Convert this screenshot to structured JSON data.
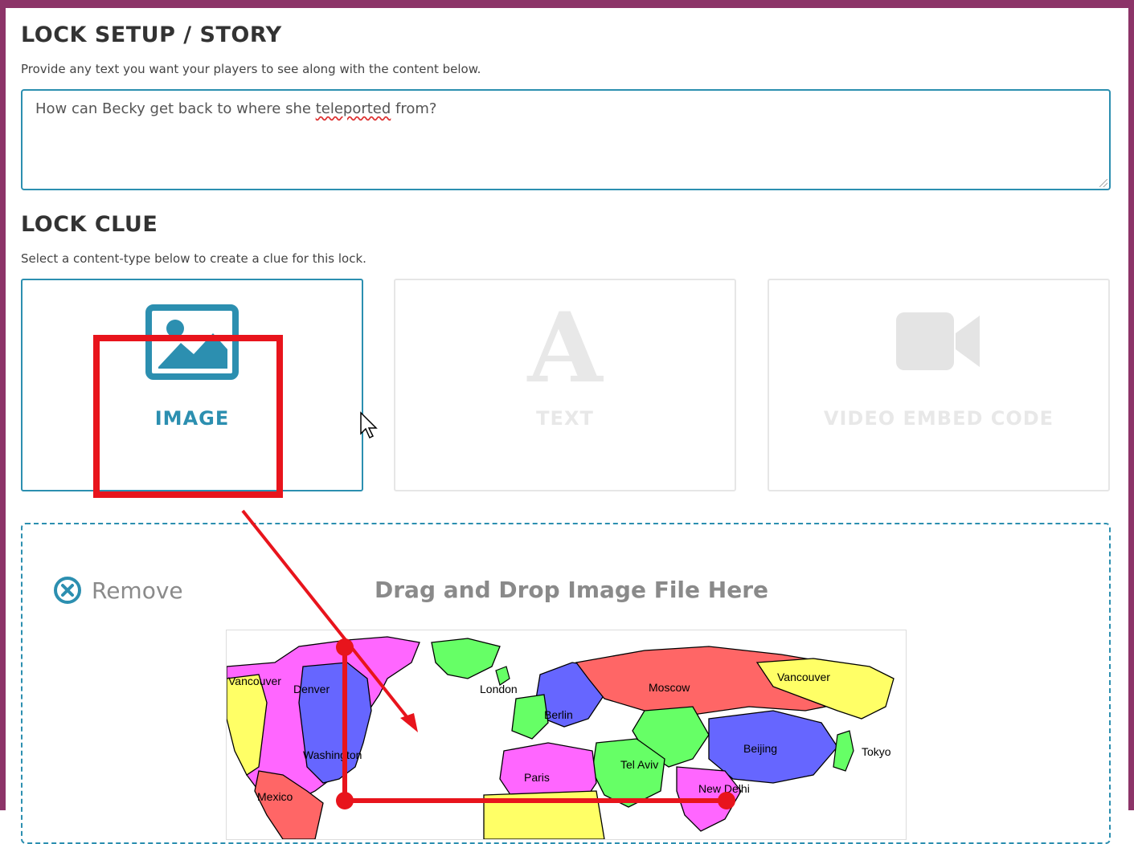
{
  "setup": {
    "heading": "LOCK SETUP / STORY",
    "description": "Provide any text you want your players to see along with the content below.",
    "story_value_before": "How can Becky get back to where she ",
    "story_value_misspelled": "teleported",
    "story_value_after": " from?"
  },
  "clue": {
    "heading": "LOCK CLUE",
    "description": "Select a content-type below to create a clue for this lock.",
    "options": [
      {
        "label": "IMAGE",
        "icon": "image-icon",
        "selected": true
      },
      {
        "label": "TEXT",
        "icon": "text-a-icon",
        "selected": false
      },
      {
        "label": "VIDEO EMBED CODE",
        "icon": "video-camera-icon",
        "selected": false
      }
    ]
  },
  "dropzone": {
    "remove_label": "Remove",
    "prompt": "Drag and Drop Image File Here"
  },
  "map": {
    "cities": [
      "Vancouver",
      "Denver",
      "London",
      "Moscow",
      "Vancouver",
      "Berlin",
      "Washington",
      "Beijing",
      "Tokyo",
      "Tel Aviv",
      "Paris",
      "New Delhi",
      "Mexico"
    ]
  },
  "colors": {
    "frame": "#8c3468",
    "accent": "#2c8fb0",
    "annotation_red": "#e8141c"
  }
}
